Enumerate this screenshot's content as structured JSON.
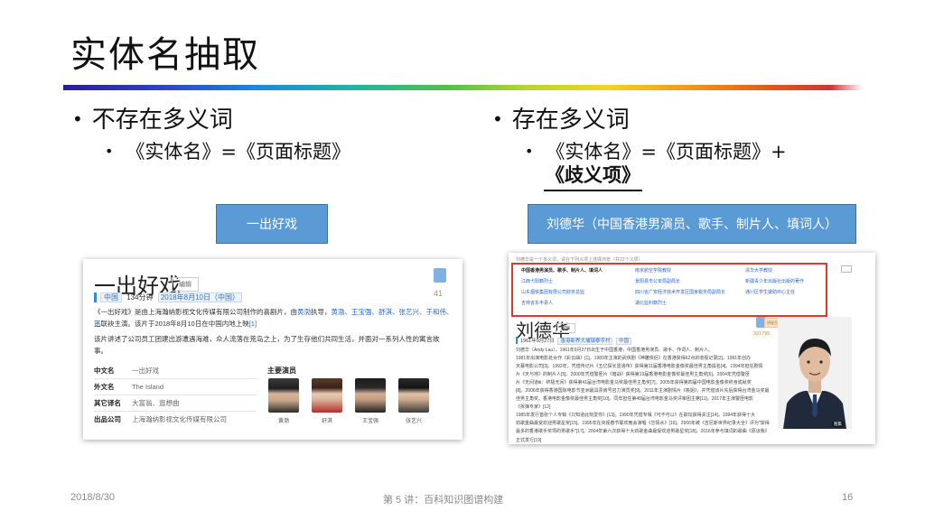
{
  "slide": {
    "title": "实体名抽取",
    "left": {
      "bullet": "不存在多义词",
      "sub": "《实体名》=《页面标题》",
      "box_label": "一出好戏"
    },
    "right": {
      "bullet": "存在多义词",
      "sub": "《实体名》=《页面标题》+",
      "sub2": "《歧义项》",
      "box_label": "刘德华（中国香港男演员、歌手、制片人、填词人）"
    },
    "footer": {
      "date": "2018/8/30",
      "lecture": "第 5 讲：百科知识图谱构建",
      "page": "16"
    }
  },
  "left_page": {
    "title": "一出好戏",
    "edit": "编辑",
    "like_count": "41",
    "meta": {
      "country": "中国",
      "duration": "134分钟",
      "release": "2018年8月10日（中国）"
    },
    "desc1_a": "《一出好戏》是由上海瀚纳影视文化传媒有限公司制作的喜剧片，由",
    "desc1_b": "黄渤",
    "desc1_c": "执导，",
    "desc1_d": "黄渤、王宝强、舒淇、张艺兴、于和伟、王",
    "desc2_a": "迅",
    "desc2_b": "联袂主演。该片于2018年8月10日在中国内地上映",
    "desc2_c": "[1]",
    "desc3": "该片讲述了公司员工团建出游遭遇海难，众人流落在荒岛之上，为了生存他们共同生活，并面对一系列人性的寓言故",
    "desc4": "事。",
    "infobox": [
      {
        "k": "中文名",
        "v": "一出好戏"
      },
      {
        "k": "外文名",
        "v": "The Island"
      },
      {
        "k": "其它译名",
        "v": "大富翁、逛想曲"
      },
      {
        "k": "出品公司",
        "v": "上海瀚纳影视文化传媒有限公司"
      }
    ],
    "cast_title": "主要演员",
    "cast": [
      "黄渤",
      "舒淇",
      "王宝强",
      "张艺兴"
    ]
  },
  "right_page": {
    "top_nav": "刘德华是一个多义词，请在下列义项上选择浏览（共22个义项）",
    "disamb": [
      "中国香港男演员、歌手、制片人、填词人",
      "江西弋阳籍烈士",
      "山东烟铁集团有限公司财务总监",
      "吉林省东丰县人",
      "南京航空学院教授",
      "景阳县市公安局副局长",
      "四川省广安经济技术开发区国家税务局副局长",
      "湖北监利籍烈士",
      "清华大学教授",
      "新疆青少年出版社出版的著作",
      "通川区学生援助中心主任",
      "湖北监利籍烈士"
    ],
    "title": "刘德华",
    "edit": "编辑",
    "badge": "明星百科",
    "like_count": "331795",
    "meta_a": "1961年9月27日",
    "meta_b": "香港新界大埔镇泰亨村",
    "meta_c": "中国",
    "paras": [
      "刘德华（Andy Lau），1961年9月27日出生于中国香港，中国香港男演员、歌手、作词人、制片人。",
      "1981年出演电影处女作《彩云曲》[1]。1983年主演的武侠剧《神雕侠侣》在香港获得62点的收视记录[2]。1991年创办",
      "天幕电影公司[3]。1992年，凭借传记片《五亿探长雷洛传》获得第11届香港电影金像奖最佳男主角提名[4]。1994年担任剧情",
      "片《天与地》的制片人[5]。2000年凭借警匪片《暗战》获得第19届香港电影金像奖最佳男主角奖[6]。2004年凭借警匪",
      "片《无间道Ⅲ：终极无间》获得第41届台湾电影金马奖最佳男主角奖[7]。2005年获得第四届中国电影金像奖终身成就奖",
      "[8]。2006年获得香港国际电影节亚洲最具票房号召力演员奖[9]。2011年主演剧情片《桃姐》，并凭借该片先后获得台湾金马奖最",
      "佳男主角奖、香港电影金像奖最佳男主角奖[10]。同年担任第48届台湾电影金马奖评审团主席[11]。2017年主演警匪电影",
      "《拆弹专家》[12]",
      "1985年发行首张个人专辑《只知道此刻爱你》[13]。1990年凭借专辑《可不可以》在歌坛获得关注[14]。1994年获得十大",
      "劲歌金曲最受欢迎男歌星奖[15]。1995年在央视春节联欢晚会演唱《忘情水》[16]。2000年被《吉尼斯世界纪录大全》评为\"获得",
      "最多的香港歌手奖项的男歌手\"[17]。2004年第六次获得十大劲歌金曲最受欢迎男歌星奖[18]。2016年参与填词的歌曲《原谅我》正式发行[19]"
    ],
    "photo_caption": "图集"
  }
}
